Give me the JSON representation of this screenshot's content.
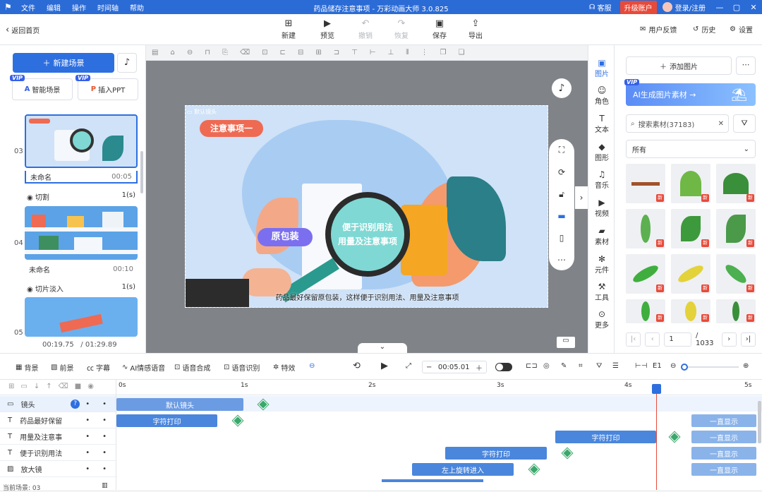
{
  "titlebar": {
    "menu": [
      "文件",
      "编辑",
      "操作",
      "时间轴",
      "帮助"
    ],
    "title": "药品储存注意事项 - 万彩动画大师 3.0.825",
    "service": "客服",
    "upgrade": "升级账户",
    "login": "登录/注册"
  },
  "toolbar": {
    "back": "返回首页",
    "new": "新建",
    "preview": "预览",
    "undo": "撤销",
    "redo": "恢复",
    "save": "保存",
    "export": "导出",
    "feedback": "用户反馈",
    "history": "历史",
    "settings": "设置"
  },
  "left": {
    "new_scene": "新建场景",
    "smart_scene": "智能场景",
    "import_ppt": "插入PPT",
    "vip": "VIP",
    "scenes": [
      {
        "num": "03",
        "name": "未命名",
        "dur": "00:05",
        "trans": "切割",
        "trans_dur": "1(s)"
      },
      {
        "num": "04",
        "name": "未命名",
        "dur": "00:10",
        "trans": "切片淡入",
        "trans_dur": "1(s)"
      },
      {
        "num": "05"
      }
    ],
    "time_current": "00:19.75",
    "time_total": "/ 01:29.89"
  },
  "stage": {
    "camera_label": "默认镜头",
    "badge": "注意事项一",
    "tag": "原包装",
    "lens_text1": "便于识别用法",
    "lens_text2": "用量及注意事项",
    "caption": "药品最好保留原包装，这样便于识别用法、用量及注意事项"
  },
  "iconbar": [
    "图片",
    "角色",
    "文本",
    "图形",
    "音乐",
    "视频",
    "素材",
    "元件",
    "工具",
    "更多"
  ],
  "rpanel": {
    "add_image": "添加图片",
    "ai_banner": "AI生成图片素材 →",
    "search_placeholder": "搜索素材(37183)",
    "select": "所有",
    "new_tag": "新",
    "page": "1",
    "page_total": "/ 1033"
  },
  "tltool": {
    "bg": "背景",
    "fg": "前景",
    "subtitle": "字幕",
    "ai_voice": "AI情感语音",
    "tts": "语音合成",
    "asr": "语音识别",
    "effects": "特效",
    "time": "00:05.01"
  },
  "timeline": {
    "ticks": [
      "0s",
      "1s",
      "2s",
      "3s",
      "4s",
      "5s"
    ],
    "tracks": [
      {
        "name": "镜头",
        "clip": "默认镜头"
      },
      {
        "name": "药品最好保留",
        "clip": "字符打印",
        "end": "一直显示"
      },
      {
        "name": "用量及注意事",
        "clip": "字符打印",
        "end": "一直显示"
      },
      {
        "name": "便于识别用法",
        "clip": "字符打印",
        "end": "一直显示"
      },
      {
        "name": "放大镜",
        "clip": "左上旋转进入",
        "end": "一直显示"
      }
    ],
    "current_scene": "当前场景: 03"
  }
}
